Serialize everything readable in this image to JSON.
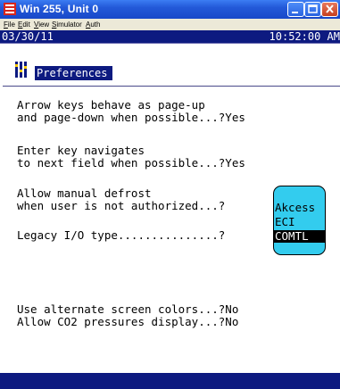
{
  "window": {
    "title": "Win 255, Unit 0",
    "icons": {
      "app": "app-icon",
      "minimize": "minimize-icon",
      "maximize": "maximize-icon",
      "close": "close-icon"
    }
  },
  "menu": [
    "File",
    "Edit",
    "View",
    "Simulator",
    "Auth"
  ],
  "status": {
    "date": "03/30/11",
    "time": "10:52:00 AM"
  },
  "screen": {
    "title": "Preferences",
    "lines": [
      "Arrow keys behave as page-up",
      "and page-down when possible...?Yes",
      "Enter key navigates",
      "to next field when possible...?Yes",
      "Allow manual defrost",
      "when user is not authorized...?",
      "Legacy I/O type...............?",
      "Use alternate screen colors...?No",
      "Allow CO2 pressures display...?No"
    ]
  },
  "popup": {
    "options": [
      "Akcess",
      "ECI",
      "COMTL"
    ],
    "selected": "COMTL"
  },
  "colors": {
    "screen_blue": "#0d1a80",
    "popup_cyan": "#33ccee"
  }
}
